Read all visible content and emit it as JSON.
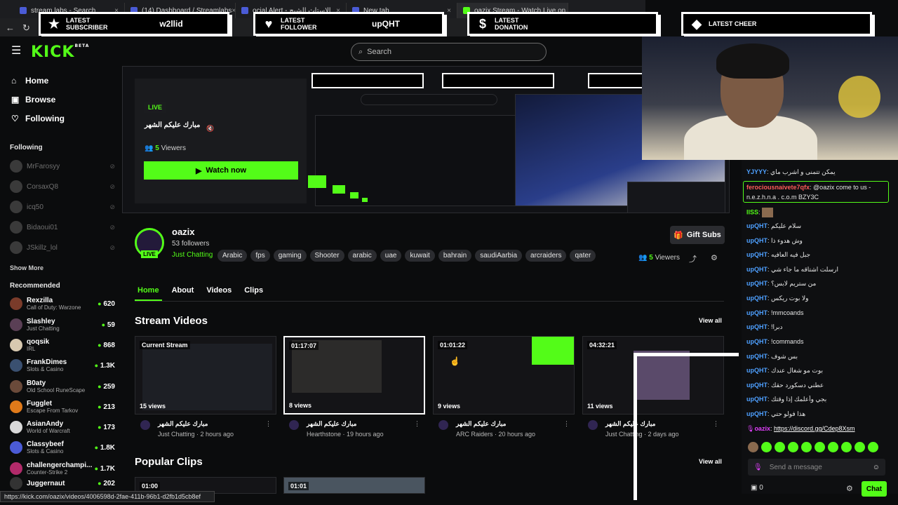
{
  "browser": {
    "tabs": [
      {
        "label": "stream labs - Search"
      },
      {
        "label": "(14) Dashboard / Streamlabs"
      },
      {
        "label": "ocial Alert - الإستاث الشبح"
      },
      {
        "label": "New tab"
      },
      {
        "label": "oazix Stream - Watch Live on Kick"
      }
    ]
  },
  "alerts": [
    {
      "icon": "star-icon",
      "glyph": "★",
      "label": "LATEST SUBSCRIBER",
      "value": "w2llid"
    },
    {
      "icon": "heart-icon",
      "glyph": "♥",
      "label": "LATEST FOLLOWER",
      "value": "upQHT"
    },
    {
      "icon": "dollar-icon",
      "glyph": "$",
      "label": "LATEST DONATION",
      "value": ""
    },
    {
      "icon": "diamond-icon",
      "glyph": "◆",
      "label": "LATEST CHEER",
      "value": ""
    }
  ],
  "header": {
    "logo": "KICK",
    "logo_sup": "BETA",
    "search_placeholder": "Search"
  },
  "sidebar": {
    "nav": [
      {
        "label": "Home",
        "icon": "home-icon",
        "glyph": "⌂"
      },
      {
        "label": "Browse",
        "icon": "browse-icon",
        "glyph": "▣"
      },
      {
        "label": "Following",
        "icon": "heart-icon",
        "glyph": "♡"
      }
    ],
    "following_title": "Following",
    "following": [
      "MrFarosyy",
      "CorsaxQ8",
      "icq50",
      "Bidaoui01",
      "JSkillz_lol"
    ],
    "show_more": "Show More",
    "recommended_title": "Recommended",
    "recommended": [
      {
        "name": "Rexzilla",
        "category": "Call of Duty: Warzone",
        "viewers": "620"
      },
      {
        "name": "Slashley",
        "category": "Just Chatting",
        "viewers": "59"
      },
      {
        "name": "qoqsik",
        "category": "IRL",
        "viewers": "868"
      },
      {
        "name": "FrankDimes",
        "category": "Slots & Casino",
        "viewers": "1.3K"
      },
      {
        "name": "B0aty",
        "category": "Old School RuneScape",
        "viewers": "259"
      },
      {
        "name": "Fugglet",
        "category": "Escape From Tarkov",
        "viewers": "213"
      },
      {
        "name": "AsianAndy",
        "category": "World of Warcraft",
        "viewers": "173"
      },
      {
        "name": "Classybeef",
        "category": "Slots & Casino",
        "viewers": "1.8K"
      },
      {
        "name": "challengerchampi...",
        "category": "Counter-Strike 2",
        "viewers": "1.7K"
      },
      {
        "name": "Juggernaut",
        "category": "",
        "viewers": "202"
      }
    ]
  },
  "preview": {
    "live": "LIVE",
    "title": "مبارك عليكم الشهر",
    "viewers_count": "5",
    "viewers_label": "Viewers",
    "watch_now": "Watch now"
  },
  "channel": {
    "name": "oazix",
    "followers": "53 followers",
    "live": "LIVE",
    "category": "Just Chatting",
    "tags": [
      "Arabic",
      "fps",
      "gaming",
      "Shooter",
      "arabic",
      "uae",
      "kuwait",
      "bahrain",
      "saudiAarbia",
      "arcraiders",
      "qater"
    ],
    "gift_subs": "Gift Subs",
    "viewers_count": "5",
    "viewers_label": "Viewers"
  },
  "tabs": [
    "Home",
    "About",
    "Videos",
    "Clips"
  ],
  "stream_videos": {
    "title": "Stream Videos",
    "view_all": "View all",
    "items": [
      {
        "duration": "Current Stream",
        "views": "15 views",
        "title": "مبارك عليكم الشهر",
        "meta": "Just Chatting · 2 hours ago"
      },
      {
        "duration": "01:17:07",
        "views": "8 views",
        "title": "مبارك عليكم الشهر",
        "meta": "Hearthstone · 19 hours ago"
      },
      {
        "duration": "01:01:22",
        "views": "9 views",
        "title": "مبارك عليكم الشهر",
        "meta": "ARC Raiders · 20 hours ago"
      },
      {
        "duration": "04:32:21",
        "views": "11 views",
        "title": "مبارك عليكم الشهر",
        "meta": "Just Chatting · 2 days ago"
      }
    ]
  },
  "popular_clips": {
    "title": "Popular Clips",
    "view_all": "View all",
    "items": [
      {
        "duration": "01:00"
      },
      {
        "duration": "01:01"
      }
    ]
  },
  "chat": {
    "messages": [
      {
        "user": "YJYYY",
        "text": "يمكن تتمنى و اشرب ماي",
        "style": ""
      },
      {
        "user": "ferociousnaivete7qfx",
        "text": "@oazix come to us -",
        "text2": "n.e.z.h.n.a . c.o.m BZY3C",
        "style": "red"
      },
      {
        "user": "IISS",
        "text": "",
        "style": "grn"
      },
      {
        "user": "upQHT",
        "text": "سلام عليكم",
        "style": ""
      },
      {
        "user": "upQHT",
        "text": "وش هدوء ذا",
        "style": ""
      },
      {
        "user": "upQHT",
        "text": "جبل فيه العافيه",
        "style": ""
      },
      {
        "user": "upQHT",
        "text": "ارسلت اشتاقه ما جاء شي",
        "style": ""
      },
      {
        "user": "upQHT",
        "text": "من ستريم لابس؟",
        "style": ""
      },
      {
        "user": "upQHT",
        "text": "ولا بوت ريكس",
        "style": ""
      },
      {
        "user": "upQHT",
        "text": "!mmcoands",
        "style": ""
      },
      {
        "user": "upQHT",
        "text": "!دبرا",
        "style": ""
      },
      {
        "user": "upQHT",
        "text": "!commands",
        "style": ""
      },
      {
        "user": "upQHT",
        "text": "بس شوف",
        "style": ""
      },
      {
        "user": "upQHT",
        "text": "بوت مو شغال عندك",
        "style": ""
      },
      {
        "user": "upQHT",
        "text": "عطني دسكورد حقك",
        "style": ""
      },
      {
        "user": "upQHT",
        "text": "بجي وأعلمك إذا وقتك",
        "style": ""
      },
      {
        "user": "upQHT",
        "text": "هذا فولو حتي",
        "style": ""
      },
      {
        "user": "oazix",
        "text": "https://discord.gg/Cdep8Xsm",
        "style": "pur"
      }
    ],
    "send_placeholder": "Send a message",
    "points": "0",
    "chat_button": "Chat"
  },
  "status_url": "https://kick.com/oazix/videos/4006598d-2fae-411b-96b1-d2fb1d5cb8ef"
}
